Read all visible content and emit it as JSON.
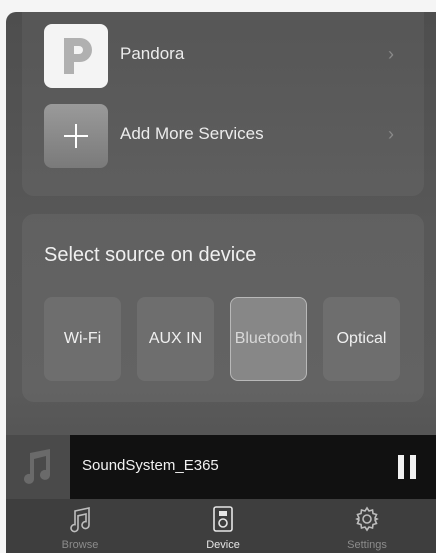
{
  "services": [
    {
      "label": "Pandora",
      "icon": "pandora-icon"
    },
    {
      "label": "Add More Services",
      "icon": "plus-icon"
    }
  ],
  "source": {
    "title": "Select source on device",
    "options": [
      "Wi-Fi",
      "AUX IN",
      "Bluetooth",
      "Optical"
    ],
    "selected": "Bluetooth"
  },
  "player": {
    "track": "SoundSystem_E365",
    "state": "playing"
  },
  "tabs": [
    {
      "label": "Browse",
      "icon": "music-note-icon"
    },
    {
      "label": "Device",
      "icon": "speaker-icon"
    },
    {
      "label": "Settings",
      "icon": "gear-icon"
    }
  ],
  "active_tab": "Device"
}
